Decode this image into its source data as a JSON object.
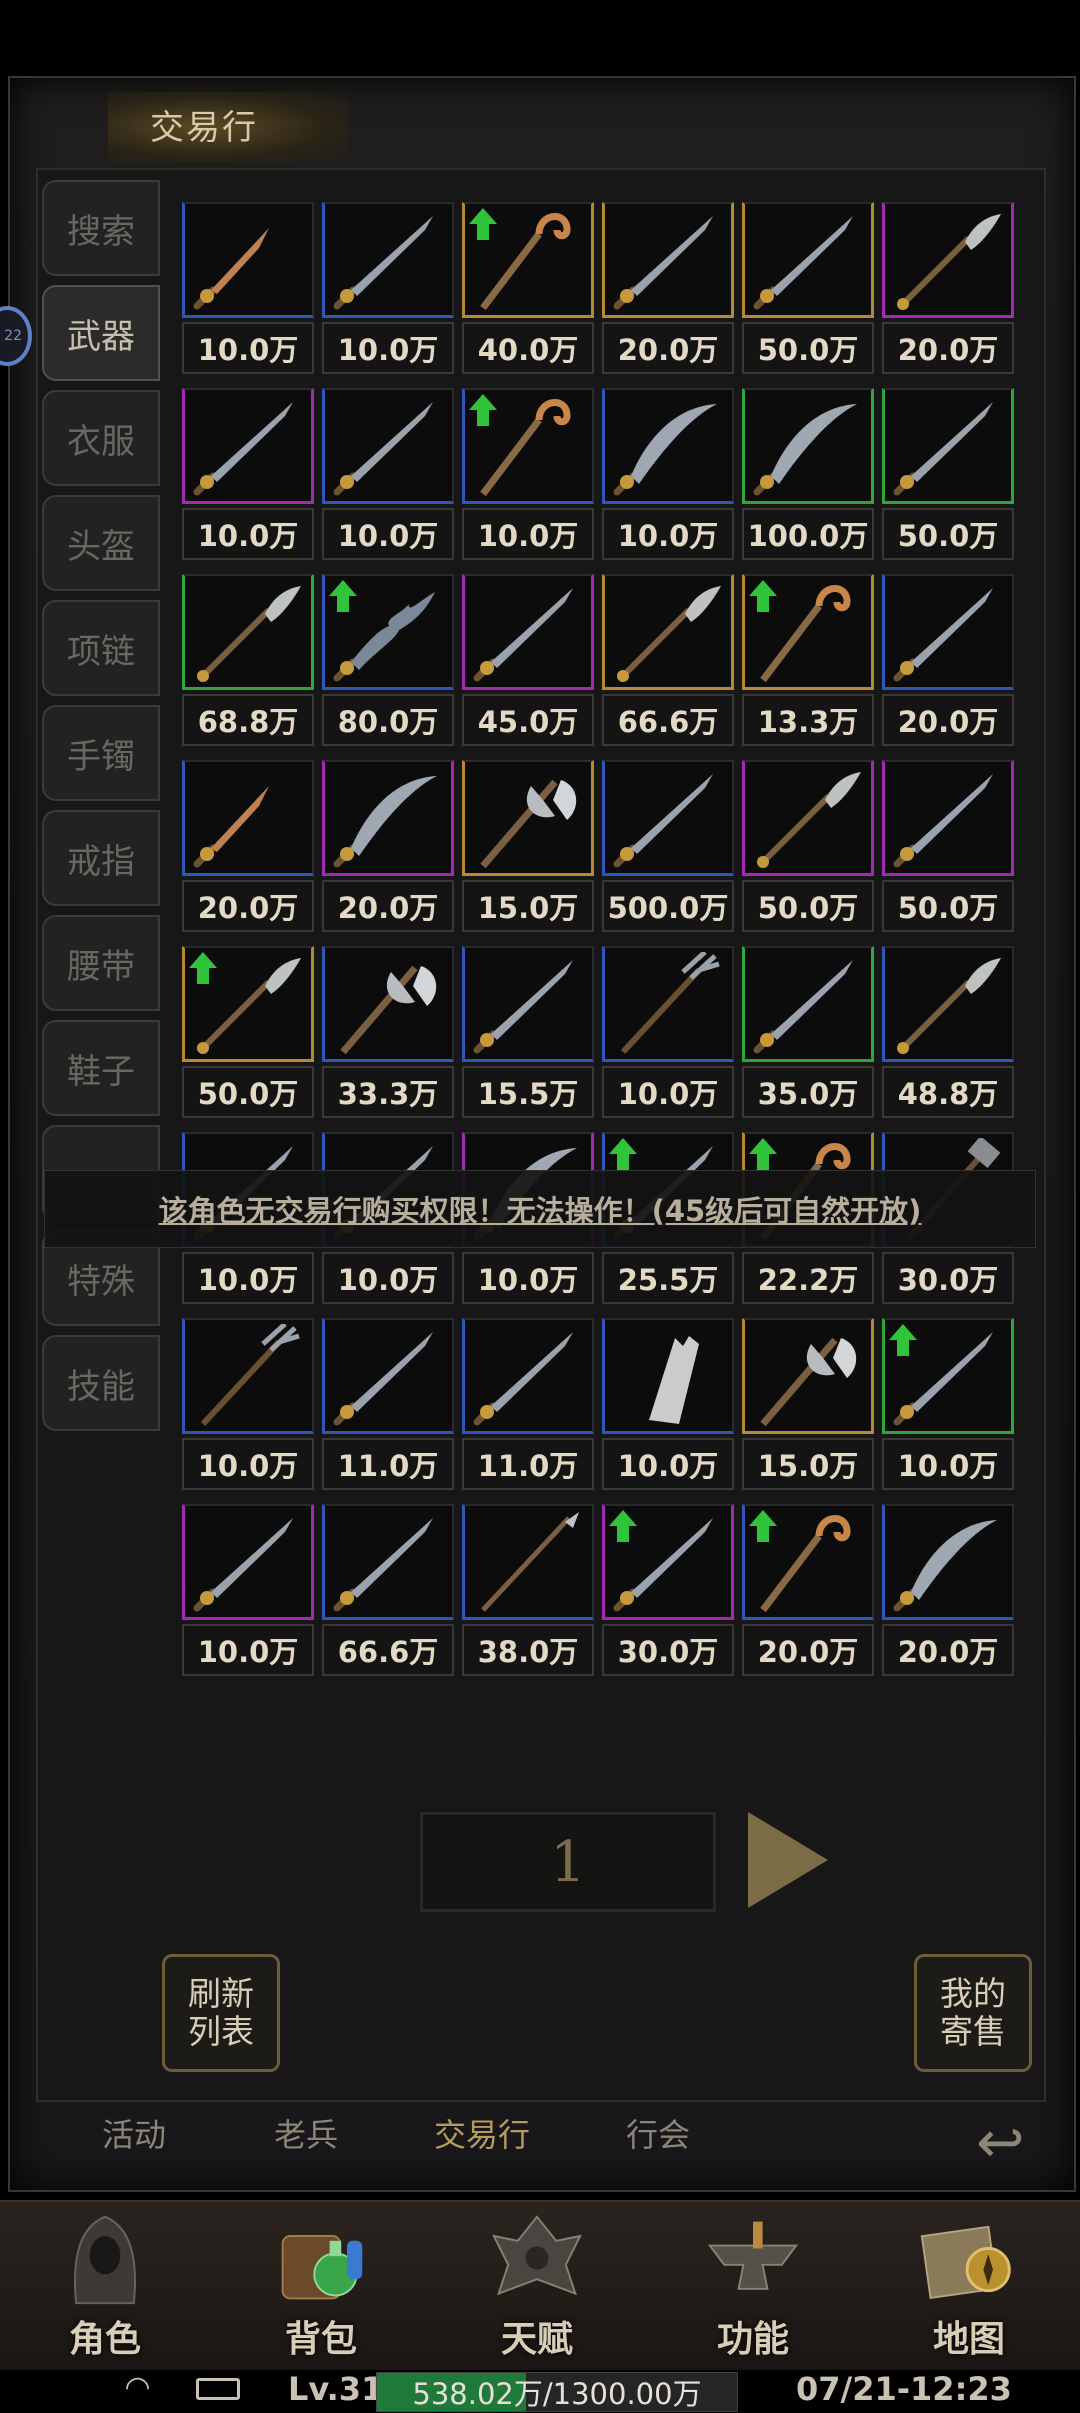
{
  "window": {
    "title": "交易行"
  },
  "badge": {
    "text": "22"
  },
  "categories": [
    "搜索",
    "武器",
    "衣服",
    "头盔",
    "项链",
    "手镯",
    "戒指",
    "腰带",
    "鞋子",
    "",
    "特殊",
    "技能"
  ],
  "active_category": "武器",
  "items": [
    {
      "price": "10.0万",
      "rarity": "blue",
      "icon": "dagger-icon",
      "upgrade": false
    },
    {
      "price": "10.0万",
      "rarity": "blue",
      "icon": "sword-icon",
      "upgrade": false
    },
    {
      "price": "40.0万",
      "rarity": "gold",
      "icon": "staff-icon",
      "upgrade": true
    },
    {
      "price": "20.0万",
      "rarity": "gold",
      "icon": "sword-icon",
      "upgrade": false
    },
    {
      "price": "50.0万",
      "rarity": "gold",
      "icon": "sword-icon",
      "upgrade": false
    },
    {
      "price": "20.0万",
      "rarity": "purple",
      "icon": "glaive-icon",
      "upgrade": false
    },
    {
      "price": "10.0万",
      "rarity": "purple",
      "icon": "sword-icon",
      "upgrade": false
    },
    {
      "price": "10.0万",
      "rarity": "blue",
      "icon": "sword-icon",
      "upgrade": false
    },
    {
      "price": "10.0万",
      "rarity": "blue",
      "icon": "staff-icon",
      "upgrade": true
    },
    {
      "price": "10.0万",
      "rarity": "blue",
      "icon": "scimitar-icon",
      "upgrade": false
    },
    {
      "price": "100.0万",
      "rarity": "green",
      "icon": "scimitar-icon",
      "upgrade": false
    },
    {
      "price": "50.0万",
      "rarity": "green",
      "icon": "sword-icon",
      "upgrade": false
    },
    {
      "price": "68.8万",
      "rarity": "green",
      "icon": "glaive-icon",
      "upgrade": false
    },
    {
      "price": "80.0万",
      "rarity": "blue",
      "icon": "flame-blade-icon",
      "upgrade": true
    },
    {
      "price": "45.0万",
      "rarity": "purple",
      "icon": "sword-icon",
      "upgrade": false
    },
    {
      "price": "66.6万",
      "rarity": "gold",
      "icon": "glaive-icon",
      "upgrade": false
    },
    {
      "price": "13.3万",
      "rarity": "gold",
      "icon": "staff-icon",
      "upgrade": true
    },
    {
      "price": "20.0万",
      "rarity": "blue",
      "icon": "sword-icon",
      "upgrade": false
    },
    {
      "price": "20.0万",
      "rarity": "blue",
      "icon": "dagger-icon",
      "upgrade": false
    },
    {
      "price": "20.0万",
      "rarity": "purple",
      "icon": "scimitar-icon",
      "upgrade": false
    },
    {
      "price": "15.0万",
      "rarity": "gold",
      "icon": "axe-icon",
      "upgrade": false
    },
    {
      "price": "500.0万",
      "rarity": "blue",
      "icon": "sword-icon",
      "upgrade": false
    },
    {
      "price": "50.0万",
      "rarity": "purple",
      "icon": "glaive-icon",
      "upgrade": false
    },
    {
      "price": "50.0万",
      "rarity": "purple",
      "icon": "sword-icon",
      "upgrade": false
    },
    {
      "price": "50.0万",
      "rarity": "gold",
      "icon": "glaive-icon",
      "upgrade": true
    },
    {
      "price": "33.3万",
      "rarity": "blue",
      "icon": "axe-icon",
      "upgrade": false
    },
    {
      "price": "15.5万",
      "rarity": "blue",
      "icon": "sword-icon",
      "upgrade": false
    },
    {
      "price": "10.0万",
      "rarity": "blue",
      "icon": "trident-icon",
      "upgrade": false
    },
    {
      "price": "35.0万",
      "rarity": "green",
      "icon": "sword-icon",
      "upgrade": false
    },
    {
      "price": "48.8万",
      "rarity": "blue",
      "icon": "glaive-icon",
      "upgrade": false
    },
    {
      "price": "10.0万",
      "rarity": "blue",
      "icon": "sword-icon",
      "upgrade": false
    },
    {
      "price": "10.0万",
      "rarity": "blue",
      "icon": "sword-icon",
      "upgrade": false
    },
    {
      "price": "10.0万",
      "rarity": "purple",
      "icon": "scimitar-icon",
      "upgrade": false
    },
    {
      "price": "25.5万",
      "rarity": "blue",
      "icon": "sword-icon",
      "upgrade": true
    },
    {
      "price": "22.2万",
      "rarity": "gold",
      "icon": "staff-icon",
      "upgrade": true
    },
    {
      "price": "30.0万",
      "rarity": "blue",
      "icon": "hammer-icon",
      "upgrade": false
    },
    {
      "price": "10.0万",
      "rarity": "blue",
      "icon": "trident-icon",
      "upgrade": false
    },
    {
      "price": "11.0万",
      "rarity": "blue",
      "icon": "sword-icon",
      "upgrade": false
    },
    {
      "price": "11.0万",
      "rarity": "blue",
      "icon": "sword-icon",
      "upgrade": false
    },
    {
      "price": "10.0万",
      "rarity": "blue",
      "icon": "broken-blade-icon",
      "upgrade": false
    },
    {
      "price": "15.0万",
      "rarity": "gold",
      "icon": "axe-icon",
      "upgrade": false
    },
    {
      "price": "10.0万",
      "rarity": "green",
      "icon": "sword-icon",
      "upgrade": true
    },
    {
      "price": "10.0万",
      "rarity": "purple",
      "icon": "sword-icon",
      "upgrade": false
    },
    {
      "price": "66.6万",
      "rarity": "blue",
      "icon": "sword-icon",
      "upgrade": false
    },
    {
      "price": "38.0万",
      "rarity": "blue",
      "icon": "spear-icon",
      "upgrade": false
    },
    {
      "price": "30.0万",
      "rarity": "purple",
      "icon": "sword-icon",
      "upgrade": true
    },
    {
      "price": "20.0万",
      "rarity": "blue",
      "icon": "staff-icon",
      "upgrade": true
    },
    {
      "price": "20.0万",
      "rarity": "blue",
      "icon": "scimitar-icon",
      "upgrade": false
    }
  ],
  "toast": "该角色无交易行购买权限！无法操作！(45级后可自然开放)",
  "pagination": {
    "page": "1"
  },
  "buttons": {
    "refresh": "刷新\n列表",
    "my_sales": "我的\n寄售"
  },
  "bottom_tabs": [
    "活动",
    "老兵",
    "交易行",
    "行会"
  ],
  "bottom_active": "交易行",
  "dock": [
    {
      "label": "角色",
      "icon": "hooded-character-icon"
    },
    {
      "label": "背包",
      "icon": "bag-potion-icon"
    },
    {
      "label": "天赋",
      "icon": "dragon-crest-icon"
    },
    {
      "label": "功能",
      "icon": "anvil-icon"
    },
    {
      "label": "地图",
      "icon": "compass-map-icon"
    }
  ],
  "status": {
    "level": "Lv.31",
    "exp": "538.02万/1300.00万",
    "exp_fraction": 0.414,
    "datetime": "07/21-12:23"
  },
  "colors": {
    "blue": "#2f56b8",
    "purple": "#a32bb3",
    "gold": "#b68a35",
    "green": "#2fa53a"
  }
}
